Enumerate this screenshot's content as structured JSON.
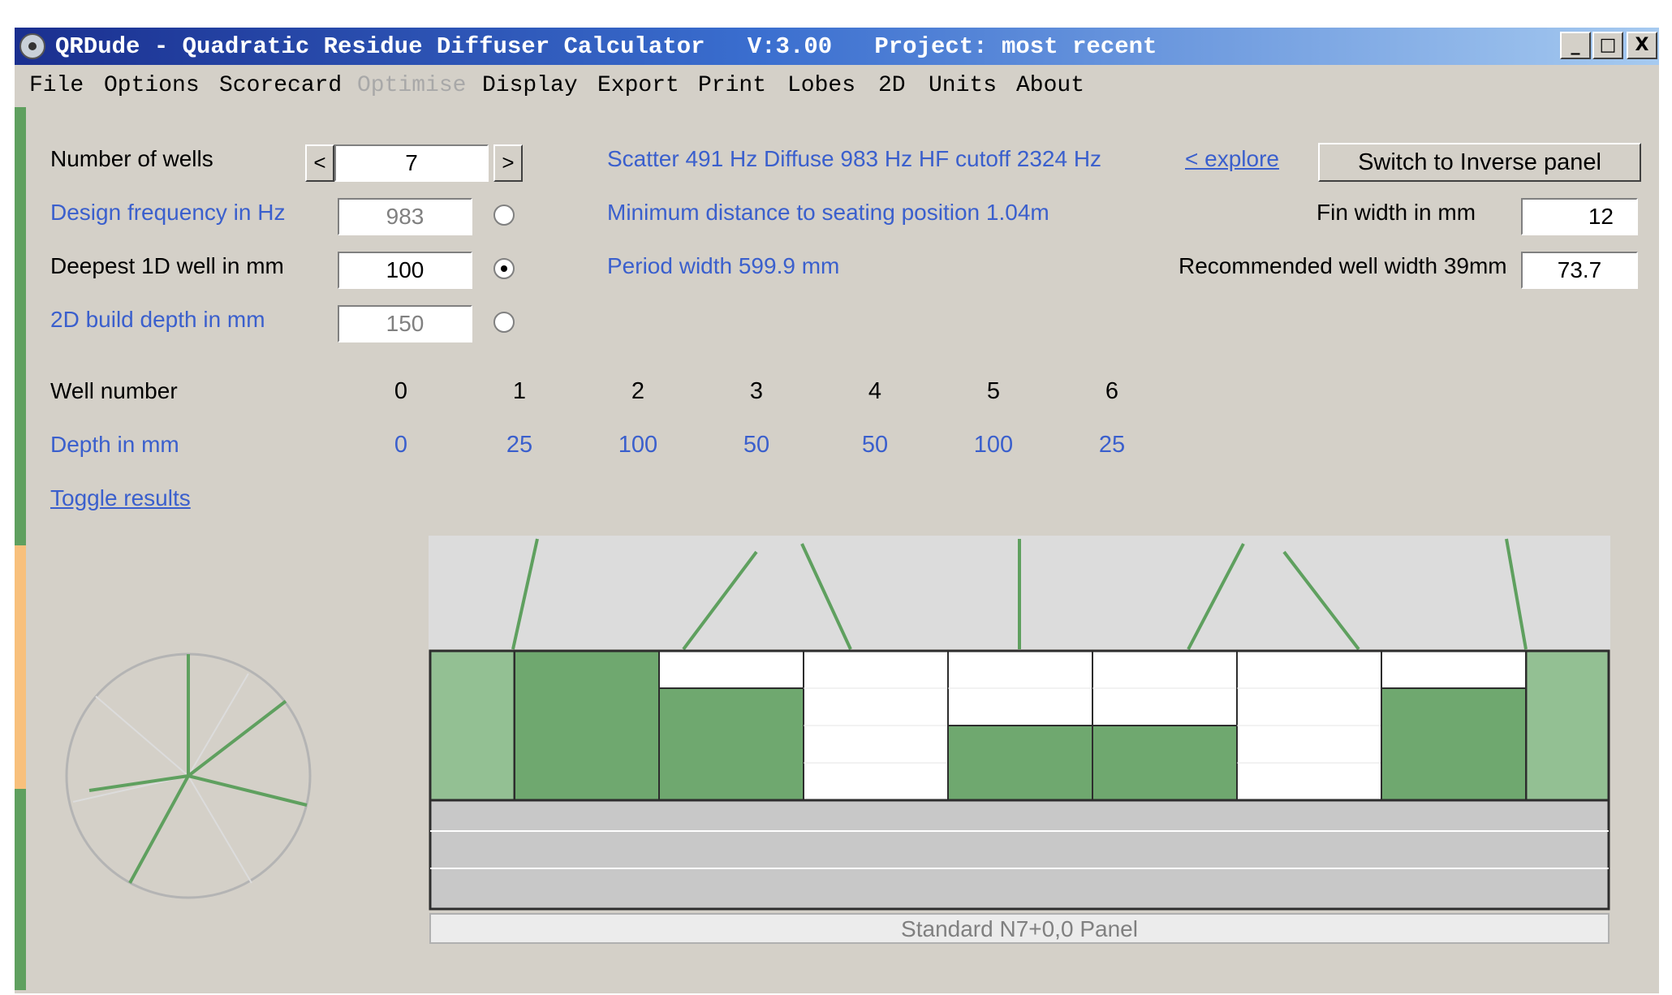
{
  "window": {
    "title": "QRDude - Quadratic Residue Diffuser Calculator   V:3.00   Project: most recent",
    "controls": [
      "_",
      "□",
      "X"
    ]
  },
  "menu": [
    "File",
    "Options",
    "Scorecard",
    "Optimise",
    "Display",
    "Export",
    "Print",
    "Lobes",
    "2D",
    "Units",
    "About"
  ],
  "menu_disabled": [
    "Optimise"
  ],
  "inputs": {
    "wells": {
      "label": "Number of wells",
      "value": "7",
      "prev": "<",
      "next": ">"
    },
    "design_freq": {
      "label": "Design frequency in Hz",
      "value": "983"
    },
    "deepest": {
      "label": "Deepest 1D well in mm",
      "value": "100"
    },
    "build_depth": {
      "label": "2D build depth in mm",
      "value": "150"
    },
    "selected_radio": "deepest"
  },
  "info": {
    "scatter": "Scatter 491 Hz  Diffuse 983 Hz  HF cutoff 2324 Hz",
    "min_distance": "Minimum distance to seating position  1.04m",
    "period_width": "Period width  599.9 mm"
  },
  "right_panel": {
    "explore": "< explore",
    "switch_button": "Switch to Inverse panel",
    "fin_label": "Fin width in mm",
    "fin_value": "12",
    "rec_label": "Recommended well width  39mm",
    "rec_value": "73.7"
  },
  "table": {
    "well_label": "Well number",
    "depth_label": "Depth in mm",
    "wells": [
      "0",
      "1",
      "2",
      "3",
      "4",
      "5",
      "6"
    ],
    "depths": [
      "0",
      "25",
      "100",
      "50",
      "50",
      "100",
      "25"
    ]
  },
  "toggle": "Toggle results",
  "panel_label": "Standard N7+0,0 Panel",
  "diagram": {
    "well_depths_mm": [
      0,
      25,
      100,
      50,
      50,
      100,
      25
    ],
    "max_depth_mm": 100,
    "colors": {
      "well": "#6fa86f",
      "fin": "#93c093",
      "base": "#c8c8c8",
      "outline": "#2d2d2d"
    }
  },
  "colors": {
    "accent_green": "#5fa05f",
    "accent_orange": "#f8c07c",
    "label_blue": "#3a5fcd"
  }
}
